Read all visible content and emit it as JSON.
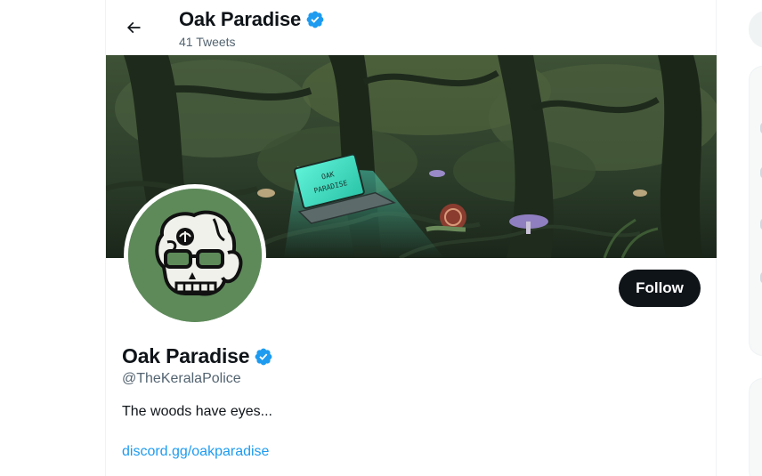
{
  "header": {
    "title": "Oak Paradise",
    "tweet_count": "41 Tweets",
    "back_icon": "arrow-left-icon"
  },
  "banner": {
    "laptop_text_1": "OAK",
    "laptop_text_2": "PARADISE"
  },
  "profile": {
    "name": "Oak Paradise",
    "handle": "@TheKeralaPolice",
    "bio": "The woods have eyes...",
    "link": "discord.gg/oakparadise",
    "follow_label": "Follow",
    "verified_icon": "verified-badge-icon"
  },
  "colors": {
    "accent": "#1d9bf0",
    "text_primary": "#0f1419",
    "text_secondary": "#536471",
    "avatar_bg": "#5e8a5a",
    "banner_bg": "#243424"
  }
}
